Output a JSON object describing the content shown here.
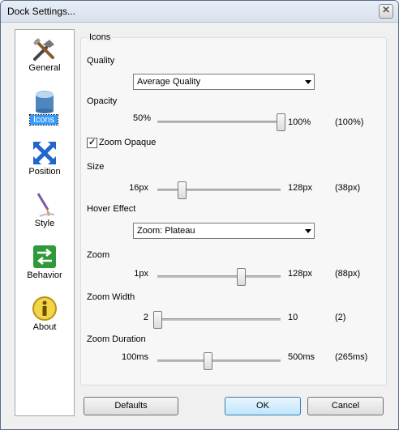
{
  "window": {
    "title": "Dock Settings..."
  },
  "sidebar": {
    "items": [
      {
        "label": "General",
        "icon": "tools-icon"
      },
      {
        "label": "Icons",
        "icon": "icons-icon"
      },
      {
        "label": "Position",
        "icon": "position-arrows-icon"
      },
      {
        "label": "Style",
        "icon": "paintbrush-icon"
      },
      {
        "label": "Behavior",
        "icon": "behavior-arrows-icon"
      },
      {
        "label": "About",
        "icon": "info-icon"
      }
    ],
    "selected": "Icons"
  },
  "panel": {
    "group_title": "Icons",
    "quality": {
      "label": "Quality",
      "value": "Average Quality"
    },
    "opacity": {
      "label": "Opacity",
      "min": "50%",
      "max": "100%",
      "current": "(100%)",
      "position": 1.0
    },
    "zoom_opaque": {
      "label": "Zoom Opaque",
      "checked": true
    },
    "size": {
      "label": "Size",
      "min": "16px",
      "max": "128px",
      "current": "(38px)",
      "position": 0.2
    },
    "hover_effect": {
      "label": "Hover Effect",
      "value": "Zoom: Plateau"
    },
    "zoom": {
      "label": "Zoom",
      "min": "1px",
      "max": "128px",
      "current": "(88px)",
      "position": 0.68
    },
    "zoom_width": {
      "label": "Zoom Width",
      "min": "2",
      "max": "10",
      "current": "(2)",
      "position": 0.0
    },
    "zoom_duration": {
      "label": "Zoom Duration",
      "min": "100ms",
      "max": "500ms",
      "current": "(265ms)",
      "position": 0.41
    }
  },
  "buttons": {
    "defaults": "Defaults",
    "ok": "OK",
    "cancel": "Cancel"
  }
}
